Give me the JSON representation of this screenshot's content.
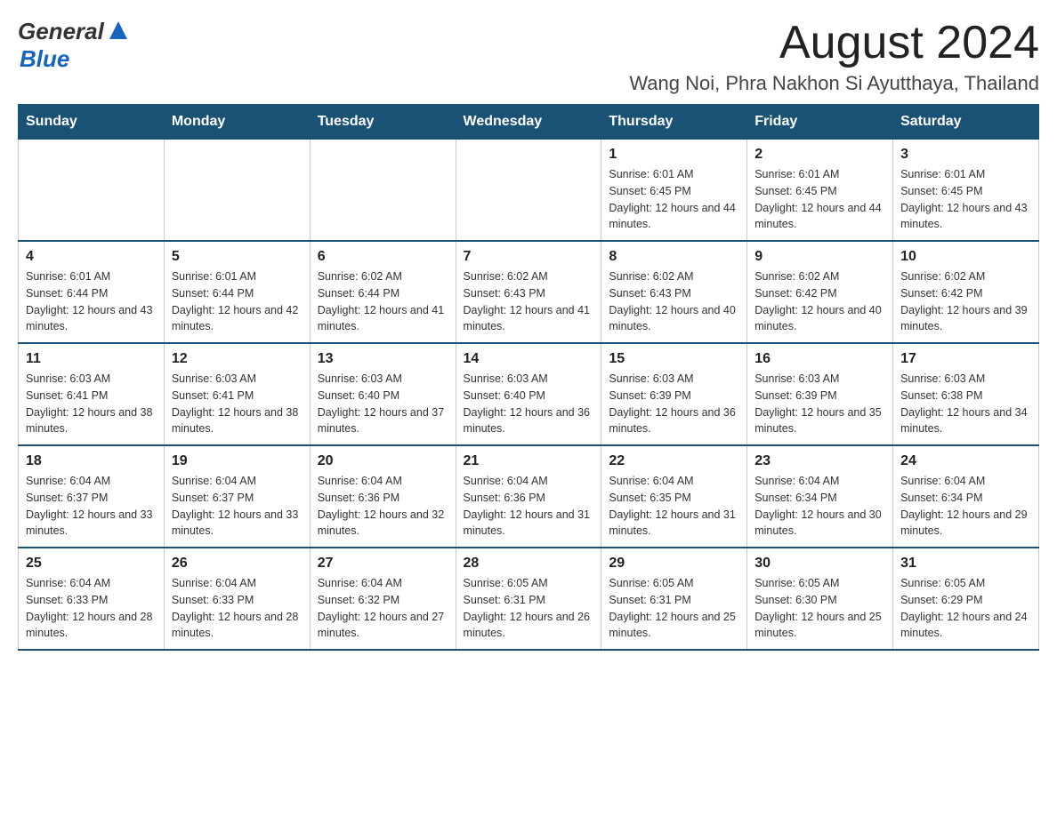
{
  "header": {
    "logo_general": "General",
    "logo_blue": "Blue",
    "main_title": "August 2024",
    "subtitle": "Wang Noi, Phra Nakhon Si Ayutthaya, Thailand"
  },
  "calendar": {
    "days_of_week": [
      "Sunday",
      "Monday",
      "Tuesday",
      "Wednesday",
      "Thursday",
      "Friday",
      "Saturday"
    ],
    "weeks": [
      [
        {
          "day": "",
          "info": ""
        },
        {
          "day": "",
          "info": ""
        },
        {
          "day": "",
          "info": ""
        },
        {
          "day": "",
          "info": ""
        },
        {
          "day": "1",
          "info": "Sunrise: 6:01 AM\nSunset: 6:45 PM\nDaylight: 12 hours and 44 minutes."
        },
        {
          "day": "2",
          "info": "Sunrise: 6:01 AM\nSunset: 6:45 PM\nDaylight: 12 hours and 44 minutes."
        },
        {
          "day": "3",
          "info": "Sunrise: 6:01 AM\nSunset: 6:45 PM\nDaylight: 12 hours and 43 minutes."
        }
      ],
      [
        {
          "day": "4",
          "info": "Sunrise: 6:01 AM\nSunset: 6:44 PM\nDaylight: 12 hours and 43 minutes."
        },
        {
          "day": "5",
          "info": "Sunrise: 6:01 AM\nSunset: 6:44 PM\nDaylight: 12 hours and 42 minutes."
        },
        {
          "day": "6",
          "info": "Sunrise: 6:02 AM\nSunset: 6:44 PM\nDaylight: 12 hours and 41 minutes."
        },
        {
          "day": "7",
          "info": "Sunrise: 6:02 AM\nSunset: 6:43 PM\nDaylight: 12 hours and 41 minutes."
        },
        {
          "day": "8",
          "info": "Sunrise: 6:02 AM\nSunset: 6:43 PM\nDaylight: 12 hours and 40 minutes."
        },
        {
          "day": "9",
          "info": "Sunrise: 6:02 AM\nSunset: 6:42 PM\nDaylight: 12 hours and 40 minutes."
        },
        {
          "day": "10",
          "info": "Sunrise: 6:02 AM\nSunset: 6:42 PM\nDaylight: 12 hours and 39 minutes."
        }
      ],
      [
        {
          "day": "11",
          "info": "Sunrise: 6:03 AM\nSunset: 6:41 PM\nDaylight: 12 hours and 38 minutes."
        },
        {
          "day": "12",
          "info": "Sunrise: 6:03 AM\nSunset: 6:41 PM\nDaylight: 12 hours and 38 minutes."
        },
        {
          "day": "13",
          "info": "Sunrise: 6:03 AM\nSunset: 6:40 PM\nDaylight: 12 hours and 37 minutes."
        },
        {
          "day": "14",
          "info": "Sunrise: 6:03 AM\nSunset: 6:40 PM\nDaylight: 12 hours and 36 minutes."
        },
        {
          "day": "15",
          "info": "Sunrise: 6:03 AM\nSunset: 6:39 PM\nDaylight: 12 hours and 36 minutes."
        },
        {
          "day": "16",
          "info": "Sunrise: 6:03 AM\nSunset: 6:39 PM\nDaylight: 12 hours and 35 minutes."
        },
        {
          "day": "17",
          "info": "Sunrise: 6:03 AM\nSunset: 6:38 PM\nDaylight: 12 hours and 34 minutes."
        }
      ],
      [
        {
          "day": "18",
          "info": "Sunrise: 6:04 AM\nSunset: 6:37 PM\nDaylight: 12 hours and 33 minutes."
        },
        {
          "day": "19",
          "info": "Sunrise: 6:04 AM\nSunset: 6:37 PM\nDaylight: 12 hours and 33 minutes."
        },
        {
          "day": "20",
          "info": "Sunrise: 6:04 AM\nSunset: 6:36 PM\nDaylight: 12 hours and 32 minutes."
        },
        {
          "day": "21",
          "info": "Sunrise: 6:04 AM\nSunset: 6:36 PM\nDaylight: 12 hours and 31 minutes."
        },
        {
          "day": "22",
          "info": "Sunrise: 6:04 AM\nSunset: 6:35 PM\nDaylight: 12 hours and 31 minutes."
        },
        {
          "day": "23",
          "info": "Sunrise: 6:04 AM\nSunset: 6:34 PM\nDaylight: 12 hours and 30 minutes."
        },
        {
          "day": "24",
          "info": "Sunrise: 6:04 AM\nSunset: 6:34 PM\nDaylight: 12 hours and 29 minutes."
        }
      ],
      [
        {
          "day": "25",
          "info": "Sunrise: 6:04 AM\nSunset: 6:33 PM\nDaylight: 12 hours and 28 minutes."
        },
        {
          "day": "26",
          "info": "Sunrise: 6:04 AM\nSunset: 6:33 PM\nDaylight: 12 hours and 28 minutes."
        },
        {
          "day": "27",
          "info": "Sunrise: 6:04 AM\nSunset: 6:32 PM\nDaylight: 12 hours and 27 minutes."
        },
        {
          "day": "28",
          "info": "Sunrise: 6:05 AM\nSunset: 6:31 PM\nDaylight: 12 hours and 26 minutes."
        },
        {
          "day": "29",
          "info": "Sunrise: 6:05 AM\nSunset: 6:31 PM\nDaylight: 12 hours and 25 minutes."
        },
        {
          "day": "30",
          "info": "Sunrise: 6:05 AM\nSunset: 6:30 PM\nDaylight: 12 hours and 25 minutes."
        },
        {
          "day": "31",
          "info": "Sunrise: 6:05 AM\nSunset: 6:29 PM\nDaylight: 12 hours and 24 minutes."
        }
      ]
    ]
  }
}
